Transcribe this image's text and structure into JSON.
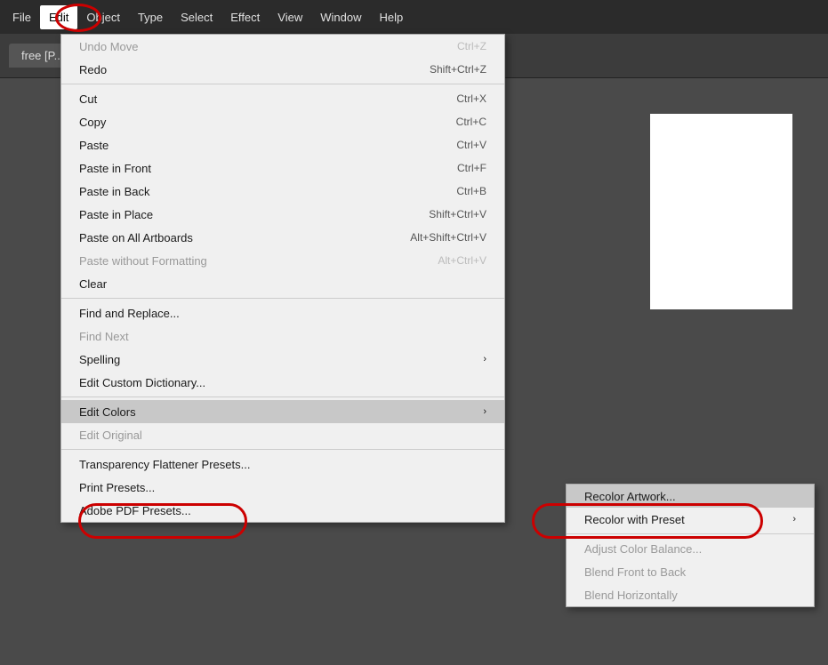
{
  "menubar": {
    "items": [
      {
        "label": "File",
        "name": "file"
      },
      {
        "label": "Edit",
        "name": "edit",
        "active": true
      },
      {
        "label": "Object",
        "name": "object"
      },
      {
        "label": "Type",
        "name": "type"
      },
      {
        "label": "Select",
        "name": "select"
      },
      {
        "label": "Effect",
        "name": "effect"
      },
      {
        "label": "View",
        "name": "view"
      },
      {
        "label": "Window",
        "name": "window"
      },
      {
        "label": "Help",
        "name": "help"
      }
    ]
  },
  "doc_tab": {
    "label": "free [P..."
  },
  "edit_menu": {
    "items": [
      {
        "label": "Undo Move",
        "shortcut": "Ctrl+Z",
        "disabled": false,
        "name": "undo"
      },
      {
        "label": "Redo",
        "shortcut": "Shift+Ctrl+Z",
        "disabled": false,
        "name": "redo"
      },
      {
        "divider": true
      },
      {
        "label": "Cut",
        "shortcut": "Ctrl+X",
        "name": "cut"
      },
      {
        "label": "Copy",
        "shortcut": "Ctrl+C",
        "name": "copy"
      },
      {
        "label": "Paste",
        "shortcut": "Ctrl+V",
        "name": "paste"
      },
      {
        "label": "Paste in Front",
        "shortcut": "Ctrl+F",
        "name": "paste-in-front"
      },
      {
        "label": "Paste in Back",
        "shortcut": "Ctrl+B",
        "name": "paste-in-back"
      },
      {
        "label": "Paste in Place",
        "shortcut": "Shift+Ctrl+V",
        "name": "paste-in-place"
      },
      {
        "label": "Paste on All Artboards",
        "shortcut": "Alt+Shift+Ctrl+V",
        "name": "paste-all-artboards"
      },
      {
        "label": "Paste without Formatting",
        "shortcut": "Alt+Ctrl+V",
        "disabled": true,
        "name": "paste-no-format"
      },
      {
        "label": "Clear",
        "shortcut": "",
        "name": "clear"
      },
      {
        "divider": true
      },
      {
        "label": "Find and Replace...",
        "shortcut": "",
        "name": "find-replace"
      },
      {
        "label": "Find Next",
        "shortcut": "",
        "disabled": true,
        "name": "find-next"
      },
      {
        "label": "Spelling",
        "shortcut": "",
        "arrow": true,
        "name": "spelling"
      },
      {
        "label": "Edit Custom Dictionary...",
        "shortcut": "",
        "name": "edit-dictionary"
      },
      {
        "divider": true
      },
      {
        "label": "Edit Colors",
        "shortcut": "",
        "arrow": true,
        "name": "edit-colors",
        "highlighted": true
      },
      {
        "label": "Edit Original",
        "shortcut": "",
        "disabled": true,
        "name": "edit-original"
      },
      {
        "divider": true
      },
      {
        "label": "Transparency Flattener Presets...",
        "shortcut": "",
        "name": "transparency-presets"
      },
      {
        "label": "Print Presets...",
        "shortcut": "",
        "name": "print-presets"
      },
      {
        "label": "Adobe PDF Presets...",
        "shortcut": "",
        "name": "pdf-presets"
      }
    ]
  },
  "edit_colors_submenu": {
    "items": [
      {
        "label": "Recolor Artwork...",
        "shortcut": "",
        "name": "recolor-artwork",
        "highlighted": true
      },
      {
        "label": "Recolor with Preset",
        "shortcut": "",
        "arrow": true,
        "name": "recolor-preset"
      },
      {
        "divider": true
      },
      {
        "label": "Adjust Color Balance...",
        "shortcut": "",
        "disabled": true,
        "name": "adjust-color"
      },
      {
        "label": "Blend Front to Back",
        "shortcut": "",
        "disabled": true,
        "name": "blend-front-back"
      },
      {
        "label": "Blend Horizontally",
        "shortcut": "",
        "disabled": true,
        "name": "blend-horizontal"
      }
    ]
  }
}
